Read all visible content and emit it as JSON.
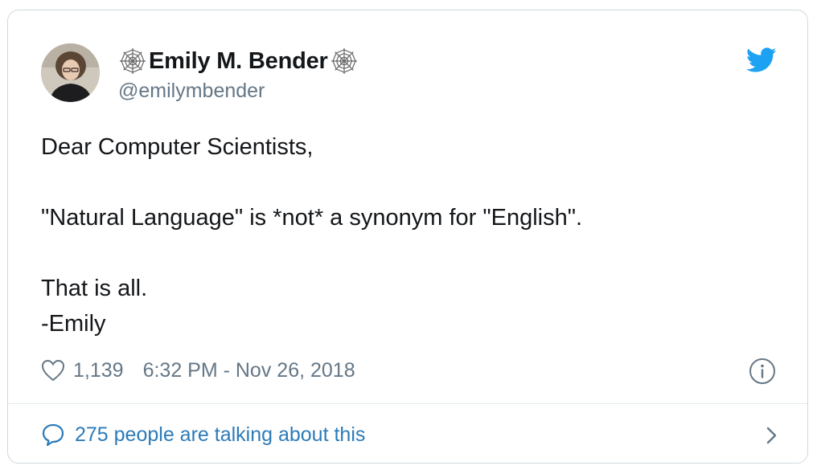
{
  "author": {
    "name_prefix_icon": "spiderweb-icon",
    "display_name": "Emily M. Bender",
    "name_suffix_icon": "spiderweb-icon",
    "handle": "@emilymbender",
    "avatar": "profile-photo"
  },
  "brand": {
    "logo_icon": "twitter-bird-icon",
    "color": "#1da1f2"
  },
  "tweet": {
    "lines": [
      "Dear Computer Scientists,",
      "",
      "\"Natural Language\" is *not* a synonym for \"English\".",
      "",
      "That is all.",
      "-Emily"
    ]
  },
  "meta": {
    "like_icon": "heart-icon",
    "like_count": "1,139",
    "timestamp": "6:32 PM - Nov 26, 2018",
    "info_icon": "info-icon"
  },
  "footer": {
    "icon": "speech-bubble-icon",
    "text": "275 people are talking about this",
    "chevron_icon": "chevron-right-icon",
    "link_color": "#2b7bb9"
  }
}
